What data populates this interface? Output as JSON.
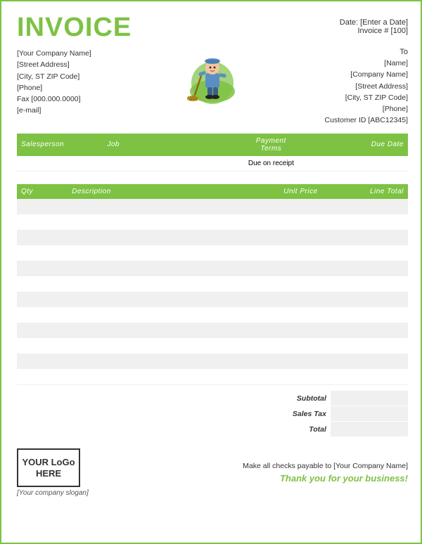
{
  "header": {
    "title": "INVOICE",
    "date_label": "Date:",
    "date_value": "[Enter a Date]",
    "invoice_label": "Invoice #",
    "invoice_value": "[100]"
  },
  "sender": {
    "company": "[Your Company Name]",
    "street": "[Street Address]",
    "city": "[City, ST  ZIP Code]",
    "phone": "[Phone]",
    "fax": "Fax [000.000.0000]",
    "email": "[e-mail]"
  },
  "to_label": "To",
  "recipient": {
    "name": "[Name]",
    "company": "[Company Name]",
    "street": "[Street Address]",
    "city": "[City, ST  ZIP Code]",
    "phone": "[Phone]",
    "customer_id": "Customer ID [ABC12345]"
  },
  "salesperson_table": {
    "headers": [
      "Salesperson",
      "Job",
      "Payment\nTerms",
      "Due Date"
    ],
    "row": {
      "salesperson": "",
      "job": "",
      "payment_terms": "Due on receipt",
      "due_date": ""
    }
  },
  "items_table": {
    "headers": [
      "Qty",
      "Description",
      "Unit Price",
      "Line Total"
    ],
    "rows": [
      {
        "qty": "",
        "desc": "",
        "unit": "",
        "total": ""
      },
      {
        "qty": "",
        "desc": "",
        "unit": "",
        "total": ""
      },
      {
        "qty": "",
        "desc": "",
        "unit": "",
        "total": ""
      },
      {
        "qty": "",
        "desc": "",
        "unit": "",
        "total": ""
      },
      {
        "qty": "",
        "desc": "",
        "unit": "",
        "total": ""
      },
      {
        "qty": "",
        "desc": "",
        "unit": "",
        "total": ""
      },
      {
        "qty": "",
        "desc": "",
        "unit": "",
        "total": ""
      },
      {
        "qty": "",
        "desc": "",
        "unit": "",
        "total": ""
      },
      {
        "qty": "",
        "desc": "",
        "unit": "",
        "total": ""
      },
      {
        "qty": "",
        "desc": "",
        "unit": "",
        "total": ""
      },
      {
        "qty": "",
        "desc": "",
        "unit": "",
        "total": ""
      },
      {
        "qty": "",
        "desc": "",
        "unit": "",
        "total": ""
      }
    ]
  },
  "totals": {
    "subtotal_label": "Subtotal",
    "tax_label": "Sales Tax",
    "total_label": "Total",
    "subtotal_value": "",
    "tax_value": "",
    "total_value": ""
  },
  "footer": {
    "logo_text": "YOUR LoGo HERE",
    "slogan": "[Your company slogan]",
    "checks_payable": "Make all checks payable to [Your Company Name]",
    "thank_you": "Thank you for your business!"
  }
}
